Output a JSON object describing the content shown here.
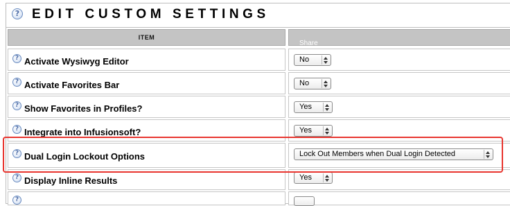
{
  "page": {
    "title": "EDIT CUSTOM SETTINGS",
    "help_icon_glyph": "?",
    "help_icon_name": "help-icon"
  },
  "table": {
    "column_item": "ITEM",
    "column_value_overlay": "Share"
  },
  "rows": [
    {
      "label": "Activate Wysiwyg Editor",
      "value": "No"
    },
    {
      "label": "Activate Favorites Bar",
      "value": "No"
    },
    {
      "label": "Show Favorites in Profiles?",
      "value": "Yes"
    },
    {
      "label": "Integrate into Infusionsoft?",
      "value": "Yes"
    },
    {
      "label": "Dual Login Lockout Options",
      "value": "Lock Out Members when Dual Login Detected",
      "highlighted": true
    },
    {
      "label": "Display Inline Results",
      "value": "Yes"
    },
    {
      "label": "",
      "value": ""
    }
  ],
  "colors": {
    "header_bg": "#c4c4c4",
    "border": "#c6c6c6",
    "highlight": "#e8342e",
    "help_icon": "#6a8cc0"
  }
}
